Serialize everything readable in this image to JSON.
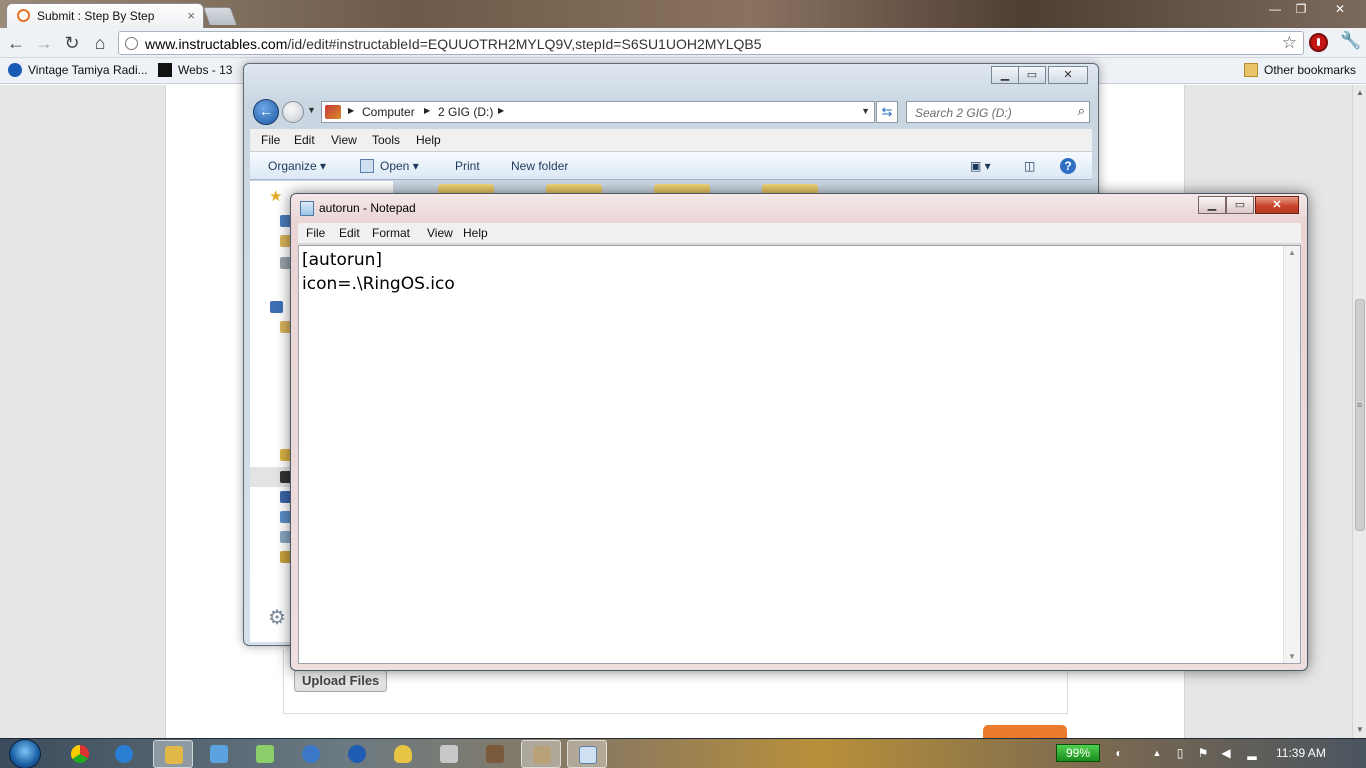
{
  "browser": {
    "tab": {
      "title": "Submit : Step By Step",
      "close": "×"
    },
    "window_controls": {
      "minimize": "—",
      "restore": "❐",
      "close": "✕"
    },
    "toolbar": {
      "back": "←",
      "forward": "→",
      "reload": "↻",
      "home": "⌂",
      "star": "☆",
      "wrench": "🔧"
    },
    "url": {
      "host": "www.instructables.com",
      "path": "/id/edit#instructableId=EQUUOTRH2MYLQ9V,stepId=S6SU1UOH2MYLQB5"
    },
    "bookmarks": [
      {
        "label": "Vintage Tamiya Radi...",
        "icon": "info-icon",
        "color": "#1a5bb5"
      },
      {
        "label": "Webs - 13",
        "icon": "webs-icon",
        "color": "#111111"
      }
    ],
    "other_bookmarks": "Other bookmarks"
  },
  "page": {
    "upload_button": "Upload Files"
  },
  "explorer": {
    "controls": {
      "minimize": "▁",
      "maximize": "▭",
      "close": "✕"
    },
    "back_arrow": "←",
    "address": {
      "root": "Computer",
      "drive": "2 GIG (D:)"
    },
    "refresh": "⇆",
    "search_placeholder": "Search 2 GIG (D:)",
    "search_icon": "⌕",
    "menus": [
      "File",
      "Edit",
      "View",
      "Tools",
      "Help"
    ],
    "commands": {
      "organize": "Organize ▾",
      "open": "Open ▾",
      "print": "Print",
      "new_folder": "New folder",
      "help": "?"
    }
  },
  "notepad": {
    "title": "autorun - Notepad",
    "controls": {
      "minimize": "▁",
      "maximize": "▭",
      "close": "✕"
    },
    "menus": [
      "File",
      "Edit",
      "Format",
      "View",
      "Help"
    ],
    "content": "[autorun]\nicon=.\\RingOS.ico"
  },
  "taskbar": {
    "battery": "99%",
    "clock": "11:39 AM",
    "tray_up": "▲"
  }
}
